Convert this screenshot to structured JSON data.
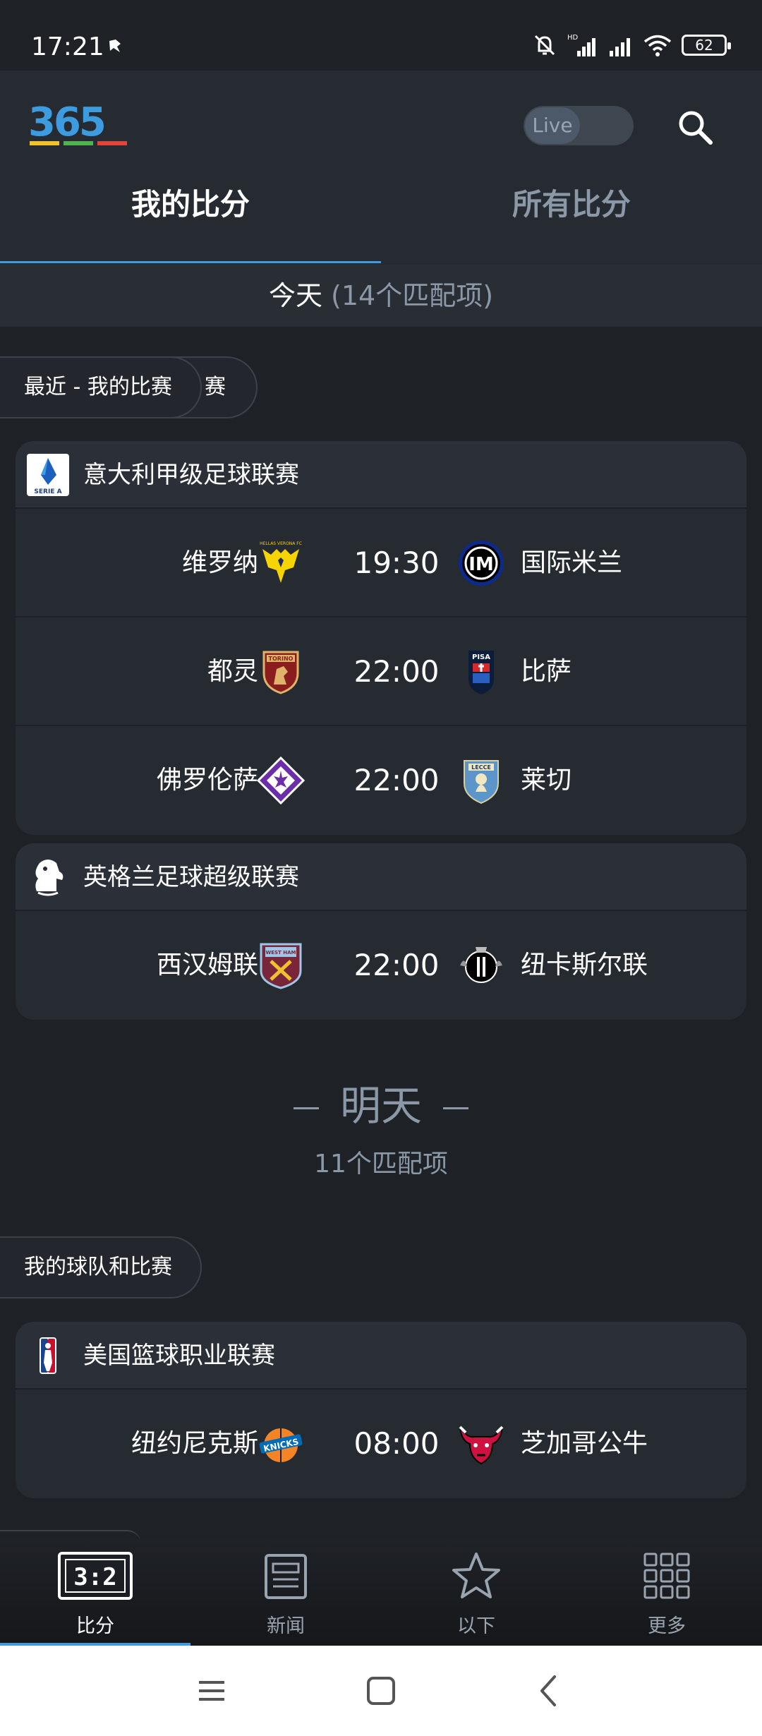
{
  "status_bar": {
    "time": "17:21",
    "battery": "62",
    "icons": [
      "notification-icon",
      "mute-icon",
      "hd-signal-icon",
      "signal-icon",
      "wifi-icon",
      "battery-icon"
    ]
  },
  "header": {
    "logo_text": "365",
    "live_label": "Live",
    "icons": [
      "search-icon"
    ]
  },
  "tabs": [
    {
      "label": "我的比分",
      "active": true
    },
    {
      "label": "所有比分",
      "active": false
    }
  ],
  "today": {
    "label": "今天",
    "count": "(14个匹配项)"
  },
  "chips": {
    "recent": "最近 - 我的比赛",
    "recent_back": "赛",
    "my_teams": "我的球队和比赛"
  },
  "leagues": [
    {
      "name": "意大利甲级足球联赛",
      "icon": "serie-a-logo",
      "matches": [
        {
          "home": "维罗纳",
          "time": "19:30",
          "away": "国际米兰"
        },
        {
          "home": "都灵",
          "time": "22:00",
          "away": "比萨"
        },
        {
          "home": "佛罗伦萨",
          "time": "22:00",
          "away": "莱切"
        }
      ]
    },
    {
      "name": "英格兰足球超级联赛",
      "icon": "premier-league-logo",
      "matches": [
        {
          "home": "西汉姆联",
          "time": "22:00",
          "away": "纽卡斯尔联"
        }
      ]
    },
    {
      "name": "美国篮球职业联赛",
      "icon": "nba-logo",
      "matches": [
        {
          "home": "纽约尼克斯",
          "time": "08:00",
          "away": "芝加哥公牛"
        }
      ]
    }
  ],
  "tomorrow": {
    "label": "明天",
    "count": "11个匹配项"
  },
  "bottom_nav": [
    {
      "label": "比分",
      "icon": "scoreboard-icon",
      "active": true,
      "icon_text": "3:2"
    },
    {
      "label": "新闻",
      "icon": "news-icon",
      "active": false
    },
    {
      "label": "以下",
      "icon": "star-icon",
      "active": false
    },
    {
      "label": "更多",
      "icon": "grid-icon",
      "active": false
    }
  ],
  "colors": {
    "background": "#1e2126",
    "accent": "#3d9be0",
    "muted_text": "#8b98a8"
  }
}
